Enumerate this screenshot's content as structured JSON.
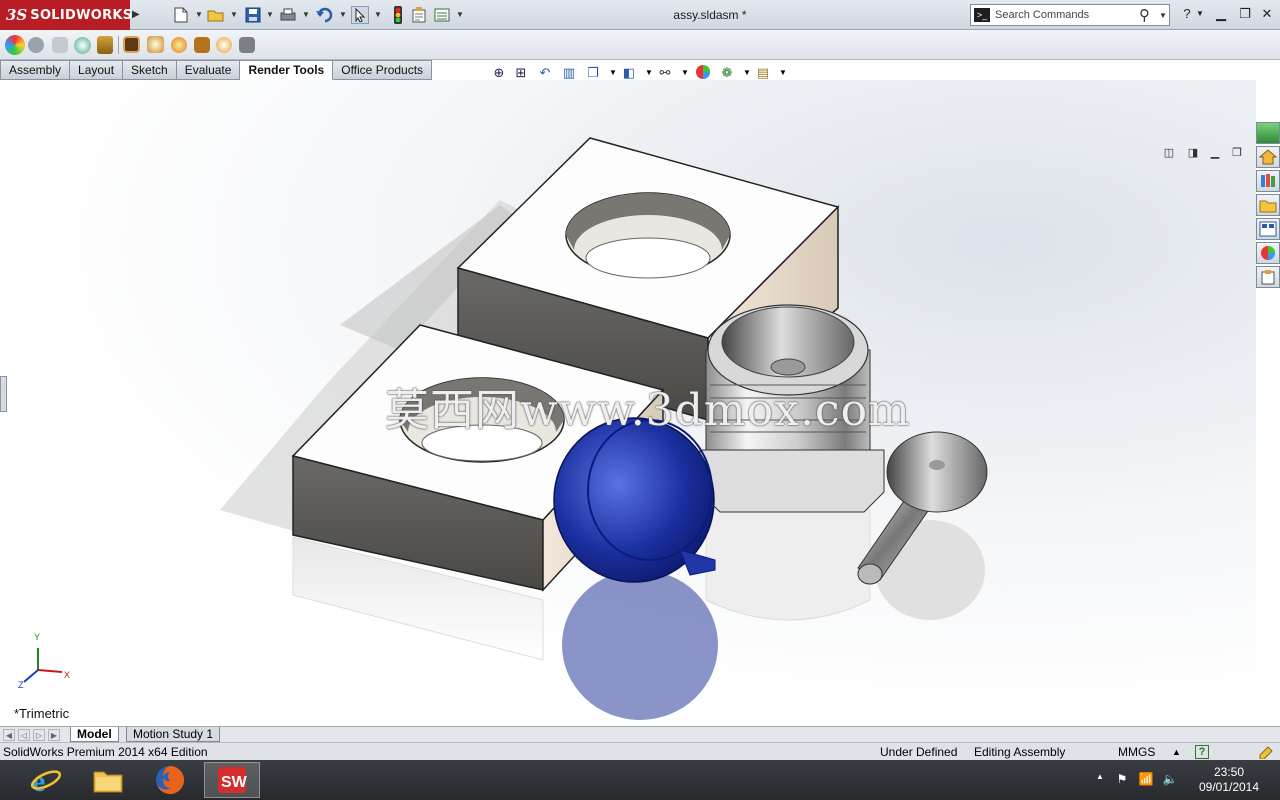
{
  "app": {
    "brand_mark": "3S",
    "brand_name": "SOLIDWORKS",
    "document_title": "assy.sldasm *"
  },
  "search": {
    "placeholder": "Search Commands"
  },
  "command_tabs": [
    {
      "label": "Assembly"
    },
    {
      "label": "Layout"
    },
    {
      "label": "Sketch"
    },
    {
      "label": "Evaluate"
    },
    {
      "label": "Render Tools",
      "active": true
    },
    {
      "label": "Office Products"
    }
  ],
  "viewport": {
    "watermark": "莫西网www.3dmox.com",
    "view_orientation": "*Trimetric",
    "axis_labels": {
      "x": "X",
      "y": "Y",
      "z": "Z"
    }
  },
  "bottom_tabs": [
    {
      "label": "Model",
      "active": true
    },
    {
      "label": "Motion Study 1"
    }
  ],
  "status": {
    "edition": "SolidWorks Premium 2014 x64 Edition",
    "definition": "Under Defined",
    "mode": "Editing Assembly",
    "units": "MMGS",
    "units_arrow": "▲",
    "help": "?"
  },
  "taskbar": {
    "time": "23:50",
    "date": "09/01/2014",
    "apps": [
      {
        "name": "internet-explorer-icon"
      },
      {
        "name": "file-explorer-icon"
      },
      {
        "name": "firefox-icon"
      },
      {
        "name": "solidworks-icon",
        "active": true
      }
    ]
  },
  "colors": {
    "brand_red": "#b81c24",
    "part_blue": "#1a2f9e",
    "titlebar": "#d6dde5"
  }
}
